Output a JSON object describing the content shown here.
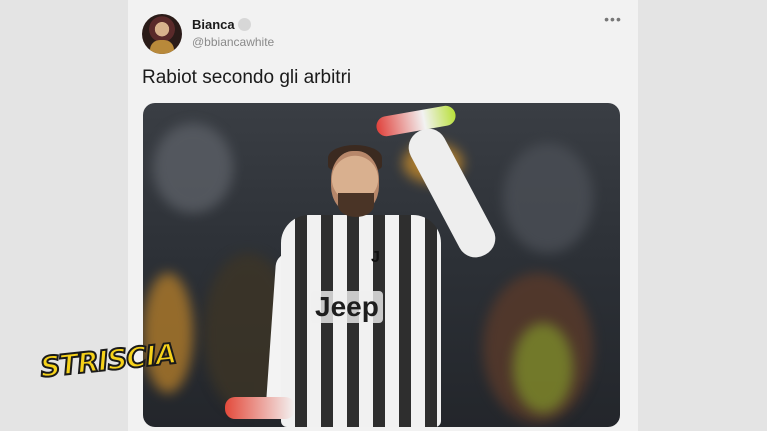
{
  "tweet": {
    "name": "Bianca",
    "handle": "@bbiancawhite",
    "text": "Rabiot secondo gli arbitri",
    "more_icon": "more-horizontal-icon"
  },
  "media": {
    "sponsor": "Jeep"
  },
  "watermark": {
    "logo_text": "STRISCIA"
  }
}
